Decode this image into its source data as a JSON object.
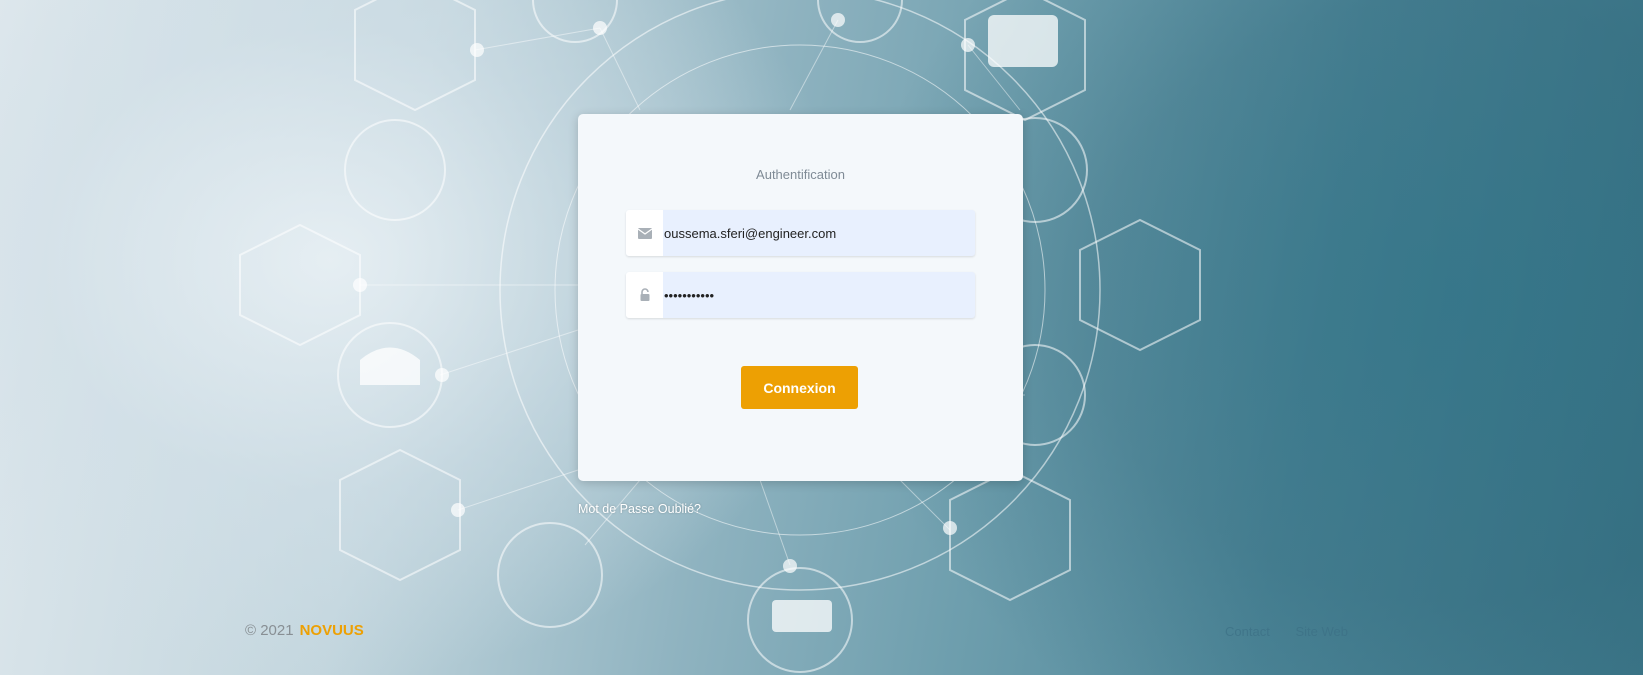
{
  "login": {
    "title": "Authentification",
    "email_value": "oussema.sferi@engineer.com",
    "password_value": "•••••••••••",
    "submit_label": "Connexion",
    "forgot_label": "Mot de Passe Oublié?",
    "email_icon": "envelope-icon",
    "password_icon": "lock-icon"
  },
  "footer": {
    "copyright": "© 2021",
    "brand": "NOVUUS",
    "links": [
      "Contact",
      "Site Web"
    ]
  },
  "colors": {
    "accent": "#eda003",
    "card": "#f4f8fb",
    "field": "#e8f0fe"
  }
}
